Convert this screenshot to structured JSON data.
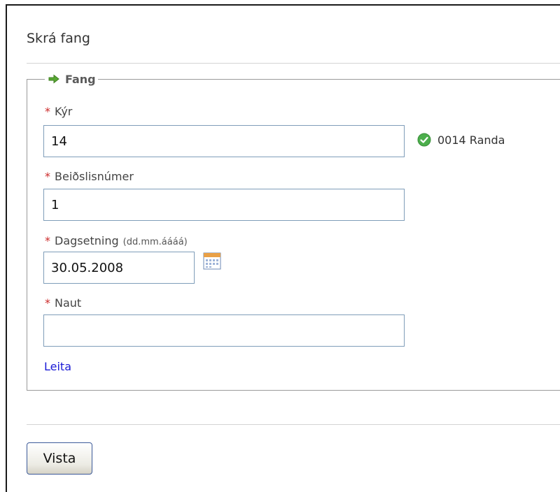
{
  "page": {
    "title": "Skrá fang"
  },
  "fieldset": {
    "legend": "Fang"
  },
  "fields": {
    "cow": {
      "required_mark": "*",
      "label": "Kýr",
      "value": "14",
      "status_text": "0014 Randa"
    },
    "request_number": {
      "required_mark": "*",
      "label": "Beiðslisnúmer",
      "value": "1"
    },
    "date": {
      "required_mark": "*",
      "label": "Dagsetning",
      "hint": "(dd.mm.áááá)",
      "value": "30.05.2008"
    },
    "bull": {
      "required_mark": "*",
      "label": "Naut",
      "value": ""
    }
  },
  "links": {
    "search": "Leita"
  },
  "actions": {
    "save": "Vista"
  },
  "icons": {
    "legend": "arrow-right-icon",
    "status": "check-circle-icon",
    "date_picker": "calendar-icon"
  },
  "colors": {
    "required": "#cc2a2a",
    "link": "#1a1ad6",
    "success": "#4cae4c",
    "arrow": "#58a832"
  }
}
